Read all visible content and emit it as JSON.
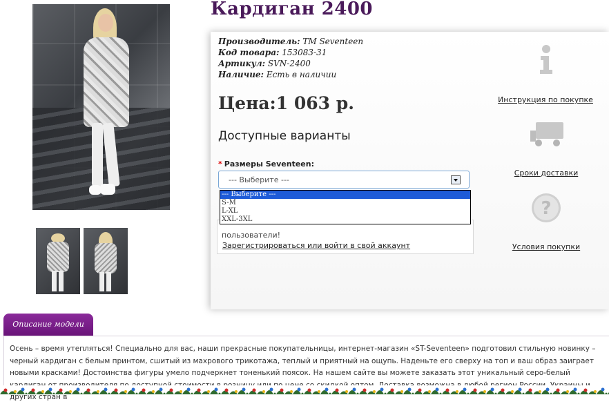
{
  "product": {
    "title": "Кардиган 2400",
    "info": [
      {
        "label": "Производитель:",
        "value": " TM Seventeen"
      },
      {
        "label": "Код товара:",
        "value": " 153083-31"
      },
      {
        "label": "Артикул:",
        "value": " SVN-2400"
      },
      {
        "label": "Наличие:",
        "value": " Есть в наличии"
      }
    ],
    "price": "Цена:1 063 р.",
    "variants_heading": "Доступные варианты"
  },
  "options": {
    "required_mark": "*",
    "size_label": "Размеры Seventeen:",
    "selected": "--- Выберите ---",
    "items": [
      "--- Выберите ---",
      "S-M",
      "L-XL",
      "XXL-3XL"
    ]
  },
  "notice": {
    "text_tail": "пользователи!",
    "login_link": "Зарегистрироваться или войти в свой аккаунт"
  },
  "side_links": {
    "instructions": "Инструкция по покупке",
    "delivery": "Сроки доставки",
    "terms": "Условия покупки"
  },
  "description": {
    "tab_label": "Описание модели",
    "text": "Осень – время утепляться! Специально для вас, наши прекрасные покупательницы, интернет-магазин «ST-Seventeen» подготовил стильную новинку – черный кардиган с белым принтом, сшитый из махрового трикотажа, теплый и приятный на ощупь. Наденьте его сверху на топ и ваш образ заиграет новыми красками! Достоинства фигуры умело подчеркнет тоненький поясок. На нашем сайте вы можете заказать этот уникальный серо-белый кардиган от производителя по доступной стоимости в розницу или по цене со скидкой оптом. Доставка возможна в любой регион России, Украины и других стран в"
  },
  "colors": {
    "title": "#4a1a5a",
    "tab": "#7a1f8a",
    "dropdown_highlight": "#1e5bd8",
    "icon_gray": "#c8c8c8"
  }
}
